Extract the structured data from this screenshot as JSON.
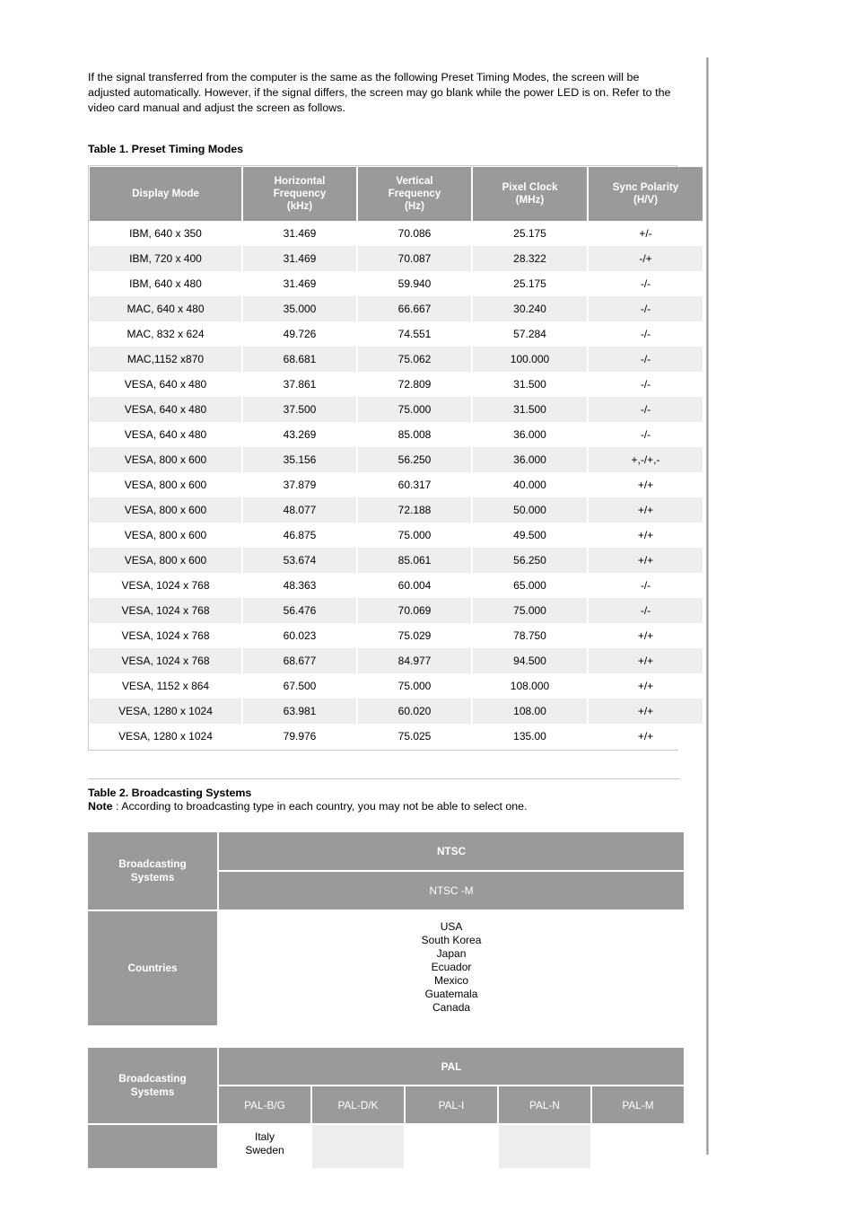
{
  "intro": {
    "paragraph": "If the signal transferred from the computer is the same as the following Preset Timing Modes, the screen will be adjusted automatically. However, if the signal differs, the screen may go blank while the power LED is on. Refer to the video card manual and adjust the screen as follows."
  },
  "table1": {
    "caption": "Table 1. Preset Timing Modes",
    "columns": [
      {
        "line1": "Display Mode",
        "line2": "",
        "line3": ""
      },
      {
        "line1": "Horizontal",
        "line2": "Frequency",
        "line3": "(kHz)"
      },
      {
        "line1": "Vertical",
        "line2": "Frequency",
        "line3": "(Hz)"
      },
      {
        "line1": "Pixel Clock",
        "line2": "(MHz)",
        "line3": ""
      },
      {
        "line1": "Sync Polarity",
        "line2": "(H/V)",
        "line3": ""
      }
    ],
    "rows": [
      [
        "IBM, 640 x 350",
        "31.469",
        "70.086",
        "25.175",
        "+/-"
      ],
      [
        "IBM, 720 x 400",
        "31.469",
        "70.087",
        "28.322",
        "-/+"
      ],
      [
        "IBM, 640 x 480",
        "31.469",
        "59.940",
        "25.175",
        "-/-"
      ],
      [
        "MAC, 640 x 480",
        "35.000",
        "66.667",
        "30.240",
        "-/-"
      ],
      [
        "MAC, 832 x 624",
        "49.726",
        "74.551",
        "57.284",
        "-/-"
      ],
      [
        "MAC,1152 x870",
        "68.681",
        "75.062",
        "100.000",
        "-/-"
      ],
      [
        "VESA, 640 x 480",
        "37.861",
        "72.809",
        "31.500",
        "-/-"
      ],
      [
        "VESA, 640 x 480",
        "37.500",
        "75.000",
        "31.500",
        "-/-"
      ],
      [
        "VESA, 640 x 480",
        "43.269",
        "85.008",
        "36.000",
        "-/-"
      ],
      [
        "VESA, 800 x 600",
        "35.156",
        "56.250",
        "36.000",
        "+,-/+,-"
      ],
      [
        "VESA, 800 x 600",
        "37.879",
        "60.317",
        "40.000",
        "+/+"
      ],
      [
        "VESA, 800 x 600",
        "48.077",
        "72.188",
        "50.000",
        "+/+"
      ],
      [
        "VESA, 800 x 600",
        "46.875",
        "75.000",
        "49.500",
        "+/+"
      ],
      [
        "VESA, 800 x 600",
        "53.674",
        "85.061",
        "56.250",
        "+/+"
      ],
      [
        "VESA, 1024 x 768",
        "48.363",
        "60.004",
        "65.000",
        "-/-"
      ],
      [
        "VESA, 1024 x 768",
        "56.476",
        "70.069",
        "75.000",
        "-/-"
      ],
      [
        "VESA, 1024 x 768",
        "60.023",
        "75.029",
        "78.750",
        "+/+"
      ],
      [
        "VESA, 1024 x 768",
        "68.677",
        "84.977",
        "94.500",
        "+/+"
      ],
      [
        "VESA, 1152 x 864",
        "67.500",
        "75.000",
        "108.000",
        "+/+"
      ],
      [
        "VESA, 1280 x 1024",
        "63.981",
        "60.020",
        "108.00",
        "+/+"
      ],
      [
        "VESA, 1280 x 1024",
        "79.976",
        "75.025",
        "135.00",
        "+/+"
      ]
    ]
  },
  "table2": {
    "caption": "Table 2. Broadcasting Systems",
    "note_label": "Note",
    "note_text": " : According to broadcasting type in each country, you may not be able to select one.",
    "row_label_systems": "Broadcasting\nSystems",
    "row_label_systems_l1": "Broadcasting",
    "row_label_systems_l2": "Systems",
    "row_label_countries": "Countries",
    "ntsc": {
      "system": "NTSC",
      "variant": "NTSC -M",
      "countries": "USA\nSouth Korea\nJapan\nEcuador\nMexico\nGuatemala\nCanada"
    },
    "pal": {
      "system": "PAL",
      "variants": [
        "PAL-B/G",
        "PAL-D/K",
        "PAL-I",
        "PAL-N",
        "PAL-M"
      ],
      "countries": [
        "Italy\nSweden",
        "",
        "",
        "",
        ""
      ]
    }
  },
  "colors": {
    "header_gray": "#9a9a9a",
    "row_alt": "#eeeeee",
    "cell_alt": "#ededed",
    "text": "#000000",
    "header_text": "#ffffff",
    "rule": "#8f8f8f"
  }
}
